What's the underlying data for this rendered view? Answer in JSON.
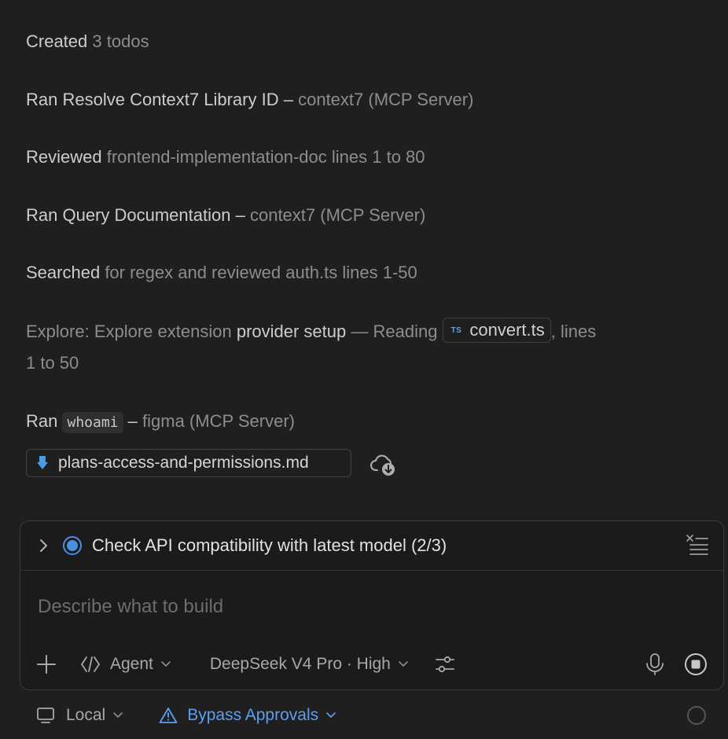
{
  "log": {
    "created": {
      "verb": "Created",
      "rest": "3 todos"
    },
    "resolve": {
      "verb": "Ran Resolve Context7 Library ID",
      "sep": "–",
      "rest": "context7 (MCP Server)"
    },
    "reviewed": {
      "verb": "Reviewed",
      "rest": "frontend-implementation-doc lines 1 to 80"
    },
    "query": {
      "verb": "Ran Query Documentation",
      "sep": "–",
      "rest": "context7 (MCP Server)"
    },
    "searched": {
      "verb": "Searched",
      "rest": "for regex and reviewed auth.ts lines 1-50"
    },
    "explore": {
      "prefix": "Explore: Explore extension",
      "highlight": "provider setup",
      "dash": "— Reading",
      "ts_badge": "TS",
      "file": "convert.ts",
      "suffix": ", lines",
      "line2": "1 to 50"
    },
    "whoami": {
      "verb": "Ran",
      "code": "whoami",
      "sep": "–",
      "rest": "figma (MCP Server)"
    }
  },
  "file_pill": {
    "name": "plans-access-and-permissions.md",
    "icon": "markdown-down-arrow-icon"
  },
  "todo": {
    "text": "Check API compatibility with latest model (2/3)"
  },
  "prompt": {
    "placeholder": "Describe what to build",
    "value": ""
  },
  "toolbar": {
    "mode": "Agent",
    "model": "DeepSeek V4 Pro · High"
  },
  "footer": {
    "env": "Local",
    "approvals": "Bypass Approvals"
  },
  "colors": {
    "background": "#1f1f20",
    "accent": "#4a8fe0",
    "link": "#5aa0f0"
  }
}
